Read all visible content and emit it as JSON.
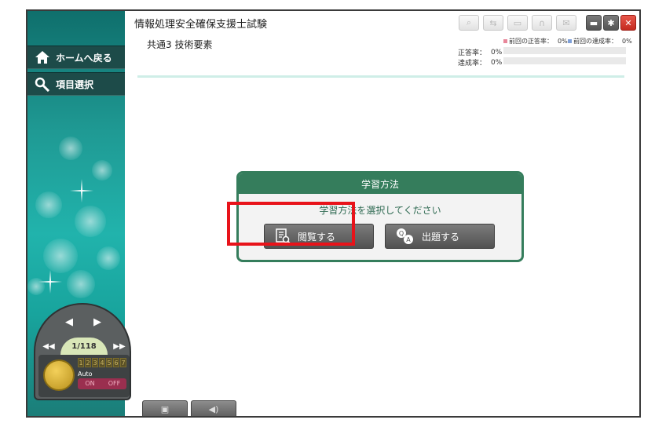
{
  "app": {
    "title": "情報処理安全確保支援士試験",
    "subtitle": "共通3 技術要素"
  },
  "nav": {
    "home_label": "ホームへ戻る",
    "select_label": "項目選択"
  },
  "stats": {
    "prev_correct_label": "前回の正答率：",
    "prev_correct_value": "0%",
    "prev_achieve_label": "前回の達成率：",
    "prev_achieve_value": "0%",
    "correct_label": "正答率：",
    "correct_value": "0%",
    "achieve_label": "達成率：",
    "achieve_value": "0%",
    "prev_correct_color": "#e8879a",
    "prev_achieve_color": "#7fa0d8"
  },
  "dialog": {
    "title": "学習方法",
    "message": "学習方法を選択してください",
    "view_button": "閲覧する",
    "quiz_button": "出題する"
  },
  "controller": {
    "page": "1/118",
    "speed_cells": [
      "1",
      "2",
      "3",
      "4",
      "5",
      "6",
      "7"
    ],
    "auto_label": "Auto",
    "on_label": "ON",
    "off_label": "OFF"
  },
  "colors": {
    "accent_green": "#357d5c",
    "highlight_red": "#e8131a",
    "sidebar_teal": "#1f9a94"
  }
}
